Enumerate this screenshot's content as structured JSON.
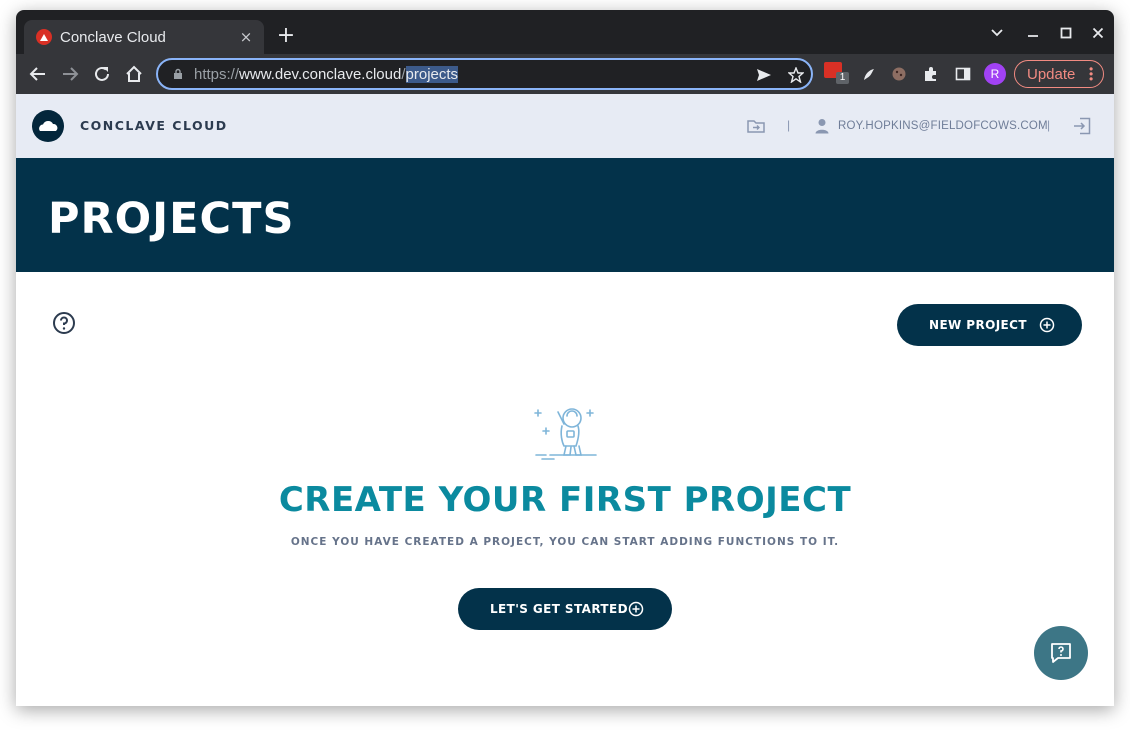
{
  "browser": {
    "tab_title": "Conclave Cloud",
    "tab_close": "×",
    "new_tab": "+",
    "url_scheme": "https://",
    "url_host": "www.dev.conclave.cloud",
    "url_slash": "/",
    "url_path": "projects",
    "extension_badge": "1",
    "profile_initial": "R",
    "update_label": "Update",
    "icons": [
      "back-icon",
      "forward-icon",
      "reload-icon",
      "home-icon",
      "lock-icon",
      "send-icon",
      "star-icon",
      "extensions-icon",
      "sidebar-icon",
      "more-icon"
    ]
  },
  "header": {
    "brand": "CONCLAVE CLOUD",
    "separator": "|",
    "user_email": "ROY.HOPKINS@FIELDOFCOWS.COM"
  },
  "hero": {
    "title": "PROJECTS"
  },
  "toolbar": {
    "new_project_label": "NEW PROJECT"
  },
  "empty_state": {
    "title": "CREATE YOUR FIRST PROJECT",
    "subtitle": "ONCE YOU HAVE CREATED A PROJECT, YOU CAN START ADDING FUNCTIONS TO IT.",
    "cta_label": "LET'S GET STARTED"
  },
  "colors": {
    "header_bg": "#e7ebf4",
    "hero_bg": "#03324a",
    "accent": "#0b8a9f",
    "fab": "#3d7686"
  }
}
